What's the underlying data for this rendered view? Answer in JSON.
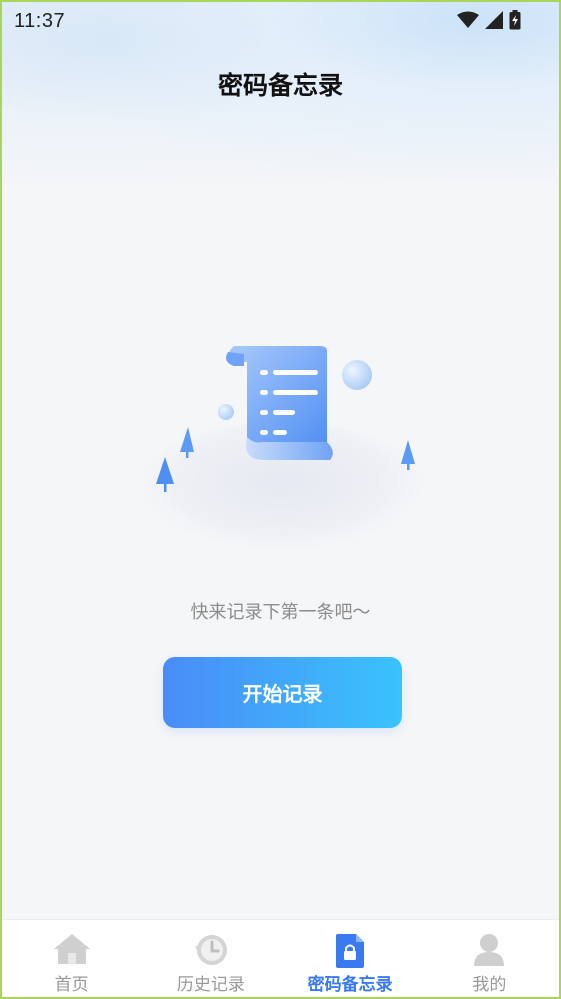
{
  "status_bar": {
    "time": "11:37",
    "icons": [
      "wifi-icon",
      "signal-icon",
      "battery-charging-icon"
    ]
  },
  "header": {
    "title": "密码备忘录"
  },
  "empty_state": {
    "illustration": "scroll-document-illustration",
    "message": "快来记录下第一条吧～",
    "button_label": "开始记录"
  },
  "tabbar": {
    "items": [
      {
        "label": "首页",
        "icon": "home-icon",
        "active": false
      },
      {
        "label": "历史记录",
        "icon": "history-clock-icon",
        "active": false
      },
      {
        "label": "密码备忘录",
        "icon": "lock-document-icon",
        "active": true
      },
      {
        "label": "我的",
        "icon": "user-icon",
        "active": false
      }
    ],
    "active_color": "#3a7af0",
    "inactive_color": "#999999"
  },
  "colors": {
    "accent_start": "#4a8cf7",
    "accent_end": "#39c3fc"
  }
}
